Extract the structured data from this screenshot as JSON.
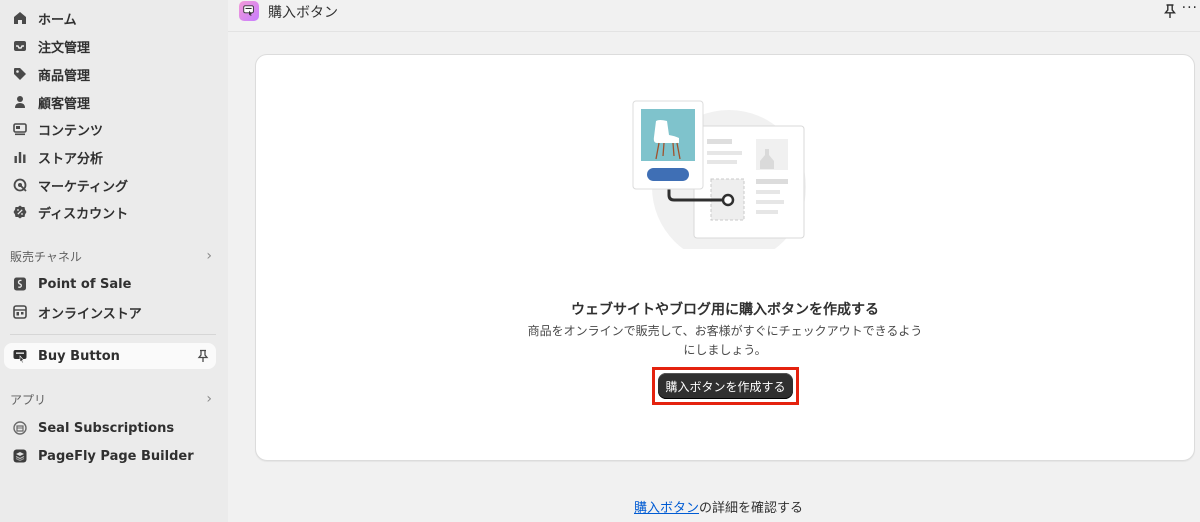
{
  "sidebar": {
    "main_items": [
      {
        "label": "ホーム",
        "icon": "home-icon"
      },
      {
        "label": "注文管理",
        "icon": "inbox-icon"
      },
      {
        "label": "商品管理",
        "icon": "tag-icon"
      },
      {
        "label": "顧客管理",
        "icon": "person-icon"
      },
      {
        "label": "コンテンツ",
        "icon": "content-icon"
      },
      {
        "label": "ストア分析",
        "icon": "bar-chart-icon"
      },
      {
        "label": "マーケティング",
        "icon": "target-icon"
      },
      {
        "label": "ディスカウント",
        "icon": "discount-icon"
      }
    ],
    "sales_channels": {
      "title": "販売チャネル",
      "items": [
        {
          "label": "Point of Sale",
          "icon": "pos-icon"
        },
        {
          "label": "オンラインストア",
          "icon": "store-icon"
        }
      ]
    },
    "active_item": {
      "label": "Buy Button",
      "icon": "buy-button-icon"
    },
    "apps": {
      "title": "アプリ",
      "items": [
        {
          "label": "Seal Subscriptions",
          "icon": "seal-icon"
        },
        {
          "label": "PageFly Page Builder",
          "icon": "pagefly-icon"
        }
      ]
    }
  },
  "header": {
    "title": "購入ボタン",
    "more": "···"
  },
  "main": {
    "heading": "ウェブサイトやブログ用に購入ボタンを作成する",
    "description": "商品をオンラインで販売して、お客様がすぐにチェックアウトできるようにしましょう。",
    "button_label": "購入ボタンを作成する"
  },
  "footer": {
    "link_text": "購入ボタン",
    "suffix": "の詳細を確認する"
  },
  "colors": {
    "sidebar_bg": "#ebebeb",
    "page_bg": "#f1f1f1",
    "primary_button": "#303030",
    "highlight_border": "#e4220e",
    "link": "#005bd3"
  }
}
